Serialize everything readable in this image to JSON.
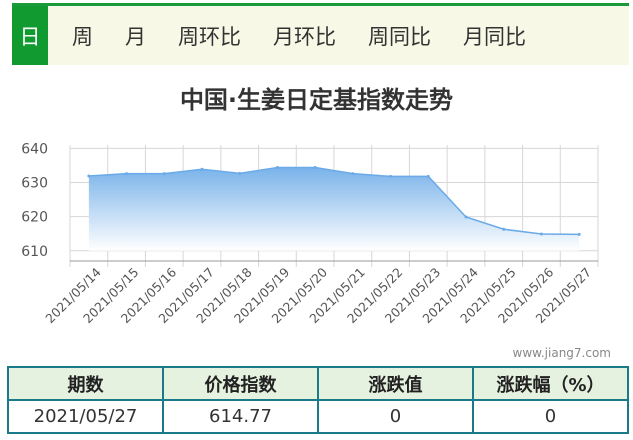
{
  "tabs": [
    {
      "label": "日",
      "active": true
    },
    {
      "label": "周",
      "active": false
    },
    {
      "label": "月",
      "active": false
    },
    {
      "label": "周环比",
      "active": false
    },
    {
      "label": "月环比",
      "active": false
    },
    {
      "label": "周同比",
      "active": false
    },
    {
      "label": "月同比",
      "active": false
    }
  ],
  "chart_data": {
    "type": "area",
    "title": "中国·生姜日定基指数走势",
    "categories": [
      "2021/05/14",
      "2021/05/15",
      "2021/05/16",
      "2021/05/17",
      "2021/05/18",
      "2021/05/19",
      "2021/05/20",
      "2021/05/21",
      "2021/05/22",
      "2021/05/23",
      "2021/05/24",
      "2021/05/25",
      "2021/05/26",
      "2021/05/27"
    ],
    "values": [
      631.9,
      632.6,
      632.6,
      633.9,
      632.7,
      634.4,
      634.4,
      632.6,
      631.8,
      631.8,
      619.9,
      616.3,
      614.9,
      614.8
    ],
    "yticks": [
      610,
      620,
      630,
      640
    ],
    "ylim": [
      607,
      641
    ],
    "grid": true,
    "colors": {
      "fill_top": "#79b2ea",
      "fill_bottom": "#ffffff",
      "line": "#6aaae8",
      "grid": "#d7d7d7"
    }
  },
  "watermark": "www.jiang7.com",
  "table": {
    "headers": [
      "期数",
      "价格指数",
      "涨跌值",
      "涨跌幅（%）"
    ],
    "row": [
      "2021/05/27",
      "614.77",
      "0",
      "0"
    ]
  }
}
